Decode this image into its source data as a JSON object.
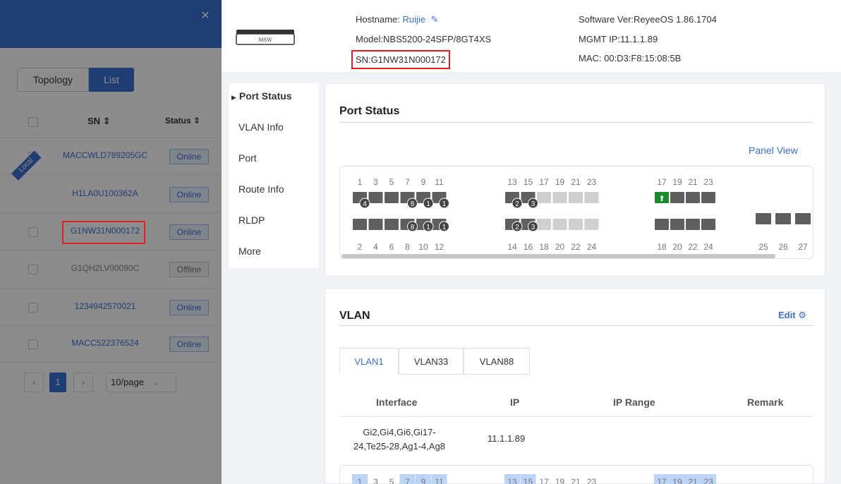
{
  "list_panel": {
    "view_tabs": [
      "Topology",
      "List"
    ],
    "columns": {
      "sn": "SN",
      "status": "Status"
    },
    "local_tag": "Local",
    "rows": [
      {
        "sn": "MACCWLD789205GC",
        "status": "Online"
      },
      {
        "sn": "H1LA0U100362A",
        "status": "Online"
      },
      {
        "sn": "G1NW31N000172",
        "status": "Online"
      },
      {
        "sn": "G1QH2LV00090C",
        "status": "Offline"
      },
      {
        "sn": "1234942570021",
        "status": "Online"
      },
      {
        "sn": "MACC522376524",
        "status": "Online"
      }
    ],
    "pager": {
      "current_page": "1",
      "page_size": "10/page"
    }
  },
  "device": {
    "image_label": "MSW",
    "hostname_label": "Hostname: ",
    "hostname": "Ruijie",
    "model": "Model:NBS5200-24SFP/8GT4XS",
    "sn": "SN:G1NW31N000172",
    "software": "Software Ver:ReyeeOS 1.86.1704",
    "mgmt_ip": "MGMT IP:11.1.1.89",
    "mac": "MAC: 00:D3:F8:15:08:5B"
  },
  "sub_nav": [
    "Port Status",
    "VLAN Info",
    "Port",
    "Route Info",
    "RLDP",
    "More"
  ],
  "port_status": {
    "title": "Port Status",
    "panel_view": "Panel View",
    "top_labels": [
      "1",
      "3",
      "5",
      "7",
      "9",
      "11",
      "13",
      "15",
      "17",
      "19",
      "21",
      "23",
      "17",
      "19",
      "21",
      "23"
    ],
    "bottom_labels": [
      "2",
      "4",
      "6",
      "8",
      "10",
      "12",
      "14",
      "16",
      "18",
      "20",
      "22",
      "24",
      "18",
      "20",
      "22",
      "24",
      "25",
      "26",
      "27"
    ],
    "aggregate_badges_top": [
      "4",
      "",
      "",
      "8",
      "1",
      "1",
      "2",
      "3"
    ],
    "aggregate_badges_bottom": [
      "",
      "",
      "",
      "8",
      "1",
      "1",
      "2",
      "3"
    ]
  },
  "vlan": {
    "title": "VLAN",
    "edit": "Edit",
    "tabs": [
      "VLAN1",
      "VLAN33",
      "VLAN88"
    ],
    "columns": [
      "Interface",
      "IP",
      "IP Range",
      "Remark"
    ],
    "row": {
      "interface_line1": "Gi2,Gi4,Gi6,Gi17-",
      "interface_line2": "24,Te25-28,Ag1-4,Ag8",
      "ip": "11.1.1.89"
    },
    "mini_labels": [
      "1",
      "3",
      "5",
      "7",
      "9",
      "11",
      "13",
      "15",
      "17",
      "19",
      "21",
      "23",
      "17",
      "19",
      "21",
      "23"
    ]
  },
  "colors": {
    "accent": "#3b6fd1",
    "highlight": "#e02020",
    "port_dark": "#5f5f5f",
    "port_idle": "#cfcfcf",
    "port_uplink": "#1a8a2a"
  }
}
